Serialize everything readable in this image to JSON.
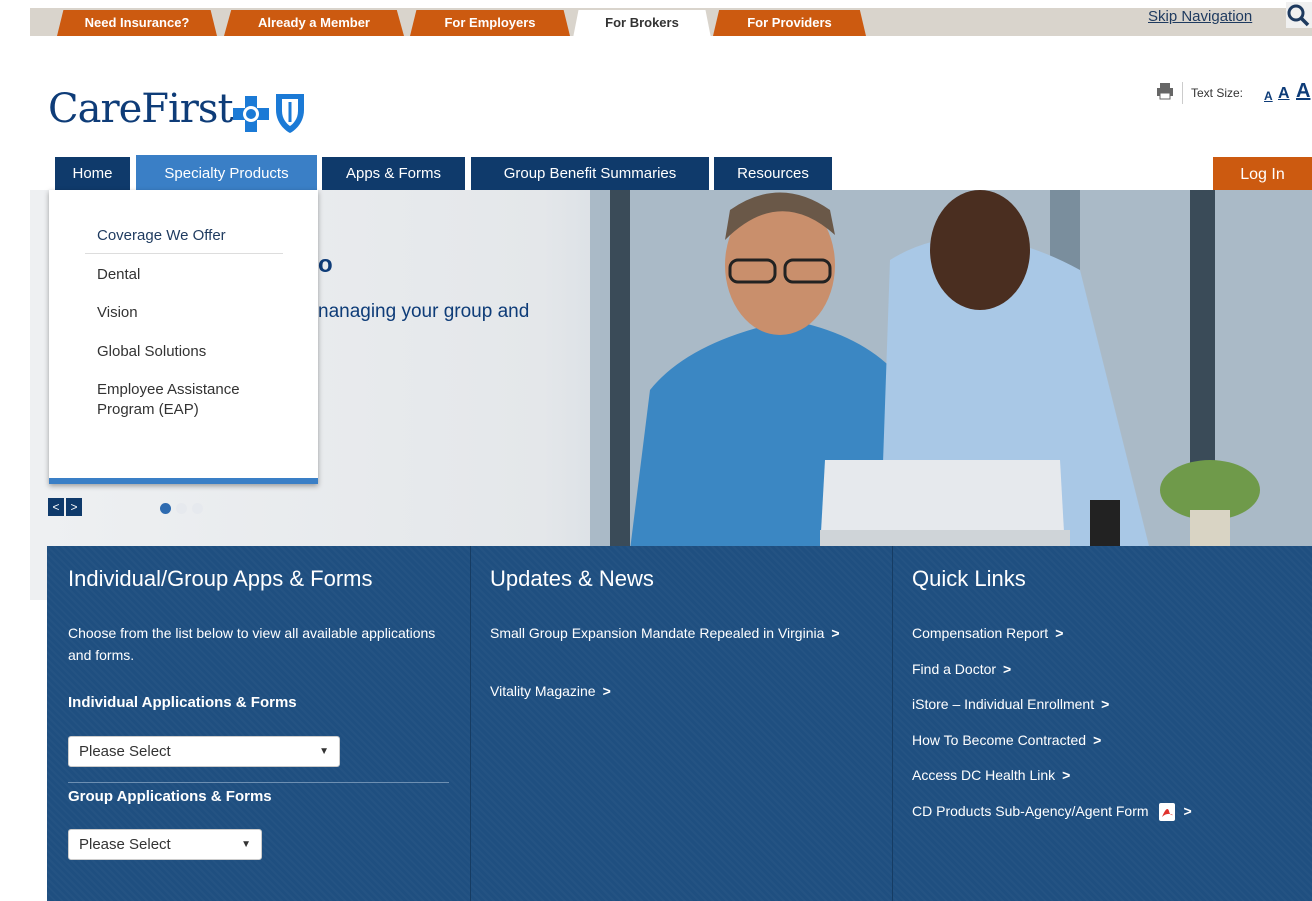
{
  "top_tabs": [
    "Need Insurance?",
    "Already a Member",
    "For Employers",
    "For Brokers",
    "For Providers"
  ],
  "active_top_tab": "For Brokers",
  "skip_navigation": "Skip Navigation",
  "logo_text": "CareFirst",
  "text_size": {
    "label": "Text Size:",
    "small": "A",
    "medium": "A",
    "large": "A"
  },
  "nav": {
    "tabs": [
      "Home",
      "Specialty Products",
      "Apps & Forms",
      "Group Benefit Summaries",
      "Resources"
    ],
    "active": "Specialty Products",
    "login": "Log In"
  },
  "dropdown": {
    "items": [
      "Coverage We Offer",
      "Dental",
      "Vision",
      "Global Solutions",
      "Employee Assistance Program (EAP)"
    ]
  },
  "hero": {
    "heading_fragment": "o",
    "text_fragment": "nanaging your group and"
  },
  "carousel": {
    "prev": "<",
    "next": ">",
    "slide_count": 3,
    "active_slide": 1
  },
  "panels": {
    "apps_forms": {
      "title": "Individual/Group Apps & Forms",
      "intro": "Choose from the list below to view all available applications and forms.",
      "individual_label": "Individual Applications & Forms",
      "individual_select": "Please Select",
      "group_label": "Group Applications & Forms",
      "group_select": "Please Select"
    },
    "news": {
      "title": "Updates & News",
      "links": [
        "Small Group Expansion Mandate Repealed in Virginia",
        "Vitality Magazine"
      ]
    },
    "quick_links": {
      "title": "Quick Links",
      "links": [
        "Compensation Report",
        "Find a Doctor",
        "iStore – Individual Enrollment",
        "How To Become Contracted",
        "Access DC Health Link",
        "CD Products Sub-Agency/Agent Form"
      ]
    }
  },
  "colors": {
    "orange": "#cc5a10",
    "navy": "#0f3a6b",
    "active_blue": "#3a7fc6",
    "panel_blue": "#1f4f80"
  }
}
